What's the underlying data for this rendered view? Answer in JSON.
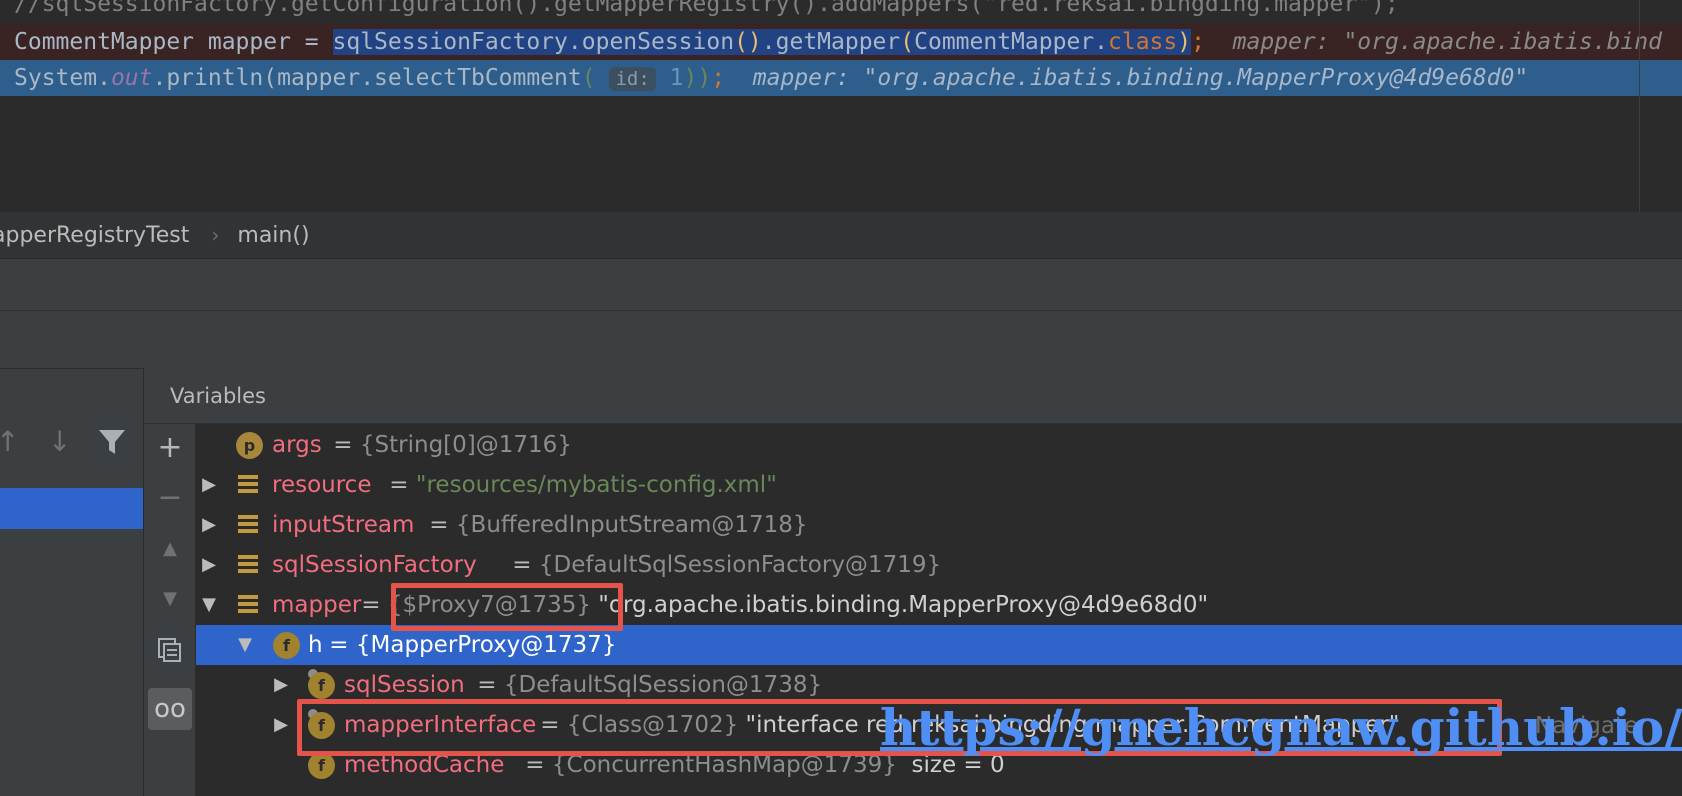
{
  "editor": {
    "line0": "//sqlSessionFactory.getConfiguration().getMapperRegistry().addMappers(\"red.reksai.bingding.mapper\");",
    "line1": {
      "decl": "CommentMapper mapper = ",
      "call_a": "sqlSessionFactory.openSession",
      "paren_a": "()",
      "call_b": ".getMapper",
      "paren_open": "(",
      "arg": "CommentMapper.",
      "kw_class": "class",
      "paren_close": ")",
      "semi": ";",
      "hint": "mapper: \"org.apache.ibatis.bind"
    },
    "line2": {
      "sys": "System.",
      "out": "out",
      "print": ".println(mapper.selectTbComment",
      "paren_open": "(",
      "inlay_label": "id:",
      "num": "1",
      "paren_close": "))",
      "semi": ";",
      "hint": "mapper: \"org.apache.ibatis.binding.MapperProxy@4d9e68d0\""
    }
  },
  "breadcrumb": {
    "class_name": "apperRegistryTest",
    "separator": "›",
    "method": "main()"
  },
  "frames": {
    "up_icon": "↑",
    "down_icon": "↓",
    "filter_icon": "filter"
  },
  "side_toolbar": {
    "add_icon": "+",
    "remove_icon": "−",
    "up_icon": "▲",
    "down_icon": "▼",
    "copy_icon": "copy",
    "glasses_icon": "oo"
  },
  "variables": {
    "header": "Variables",
    "rows": [
      {
        "badge": "p",
        "name": "args",
        "eq": " = ",
        "ref": "{String[0]@1716}",
        "extra": ""
      },
      {
        "name": "resource",
        "eq": " = ",
        "ref": "",
        "extra": "\"resources/mybatis-config.xml\""
      },
      {
        "name": "inputStream",
        "eq": " = ",
        "ref": "{BufferedInputStream@1718}",
        "extra": ""
      },
      {
        "name": "sqlSessionFactory",
        "eq": " = ",
        "ref": "{DefaultSqlSessionFactory@1719}",
        "extra": ""
      },
      {
        "name": "mapper",
        "eq": " = ",
        "ref": "{$Proxy7@1735}",
        "extra": " \"org.apache.ibatis.binding.MapperProxy@4d9e68d0\""
      },
      {
        "badge": "f",
        "name": "h",
        "eq": " = ",
        "ref": "{MapperProxy@1737}",
        "extra": ""
      },
      {
        "badge": "f",
        "name": "sqlSession",
        "eq": " = ",
        "ref": "{DefaultSqlSession@1738}",
        "extra": ""
      },
      {
        "badge": "f",
        "name": "mapperInterface",
        "eq": " = ",
        "ref": "{Class@1702}",
        "extra": " \"interface red.reksai.bingding.mapper.CommentMapper\"",
        "action": "Navigate"
      },
      {
        "badge": "f",
        "name": "methodCache",
        "eq": " = ",
        "ref": "{ConcurrentHashMap@1739}",
        "extra": "  size = 0"
      }
    ]
  },
  "watermark": "https://gnehcgnaw.github.io/",
  "colors": {
    "selection": "#2f65ca",
    "highlight_box": "#e5544b",
    "var_name": "#f26d7d",
    "string_value": "#6a8759"
  }
}
